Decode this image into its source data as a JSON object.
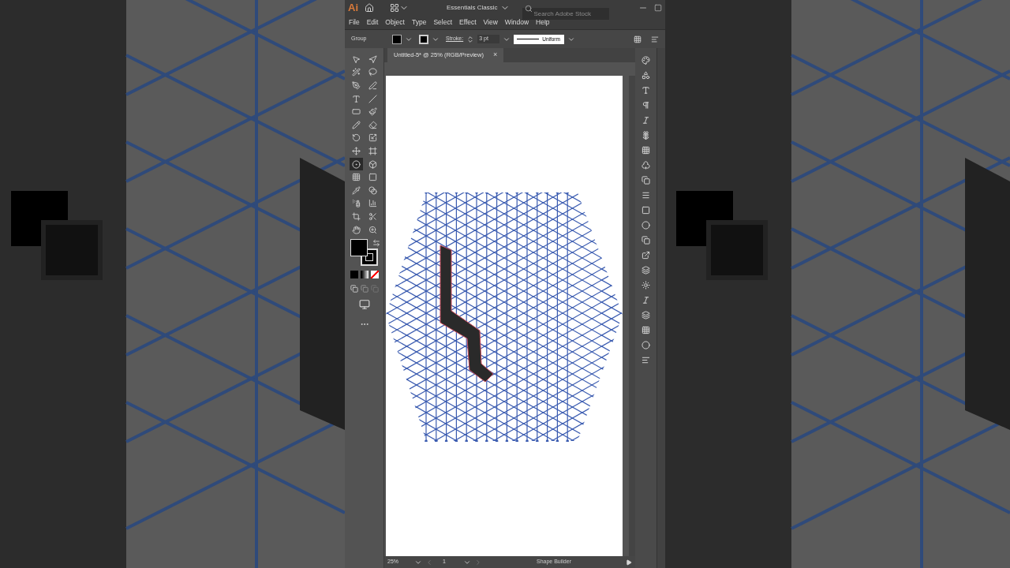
{
  "app_bar": {
    "logo": "Ai",
    "workspace": "Essentials Classic",
    "search": {
      "placeholder": "Search Adobe Stock"
    }
  },
  "menu": [
    "File",
    "Edit",
    "Object",
    "Type",
    "Select",
    "Effect",
    "View",
    "Window",
    "Help"
  ],
  "control_bar": {
    "selection": "Group",
    "stroke_label": "Stroke:",
    "stroke_weight": "3 pt",
    "profile": "Uniform"
  },
  "document_tab": {
    "title": "Untitled-5* @ 25% (RGB/Preview)",
    "close": "×"
  },
  "tools": [
    {
      "selected": false
    },
    {
      "selected": false
    },
    {
      "selected": false
    },
    {
      "selected": false
    },
    {
      "selected": false
    },
    {
      "selected": false
    },
    {
      "selected": false
    },
    {
      "selected": false
    },
    {
      "selected": false
    },
    {
      "selected": false
    },
    {
      "selected": false
    },
    {
      "selected": false
    },
    {
      "selected": false
    },
    {
      "selected": false
    },
    {
      "selected": false
    },
    {
      "selected": false
    },
    {
      "selected": true
    },
    {
      "selected": false
    },
    {
      "selected": false
    },
    {
      "selected": false
    },
    {
      "selected": false
    },
    {
      "selected": false
    },
    {
      "selected": false
    },
    {
      "selected": false
    },
    {
      "selected": false
    },
    {
      "selected": false
    },
    {
      "selected": false
    },
    {
      "selected": false
    }
  ],
  "status_bar": {
    "zoom": "25%",
    "artboard": "1",
    "current_tool": "Shape Builder"
  }
}
